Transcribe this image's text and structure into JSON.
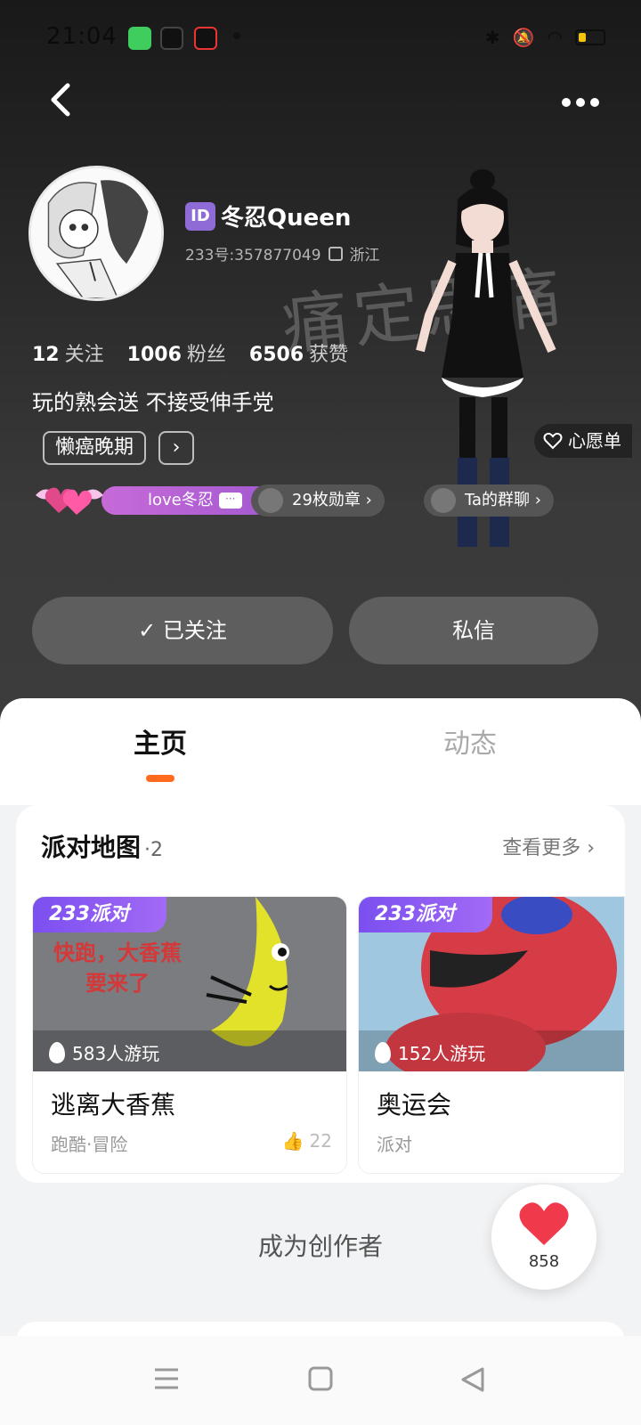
{
  "status_bar": {
    "time": "21:04",
    "apps": [
      "wechat-app-icon",
      "tiktok-icon",
      "tiktok-lite-icon"
    ]
  },
  "profile": {
    "id_badge": "ID",
    "username": "冬忍Queen",
    "uid": "233号:357877049",
    "location": "浙江",
    "watermark": "痛定思痛",
    "stats": [
      {
        "num": "12",
        "label": "关注"
      },
      {
        "num": "1006",
        "label": "粉丝"
      },
      {
        "num": "6506",
        "label": "获赞"
      }
    ],
    "bio": "玩的熟会送 不接受伸手党",
    "tag": "懒癌晚期",
    "wishlist": "心愿单",
    "love_pill": "love冬忍",
    "badges_pill": "29枚勋章",
    "group_pill": "Ta的群聊"
  },
  "actions": {
    "follow": "已关注",
    "message": "私信"
  },
  "tabs": [
    {
      "label": "主页"
    },
    {
      "label": "动态"
    }
  ],
  "party_map": {
    "title": "派对地图",
    "count": "·2",
    "more": "查看更多",
    "games": [
      {
        "badge": "233派对",
        "players": "583人游玩",
        "name": "逃离大香蕉",
        "category": "跑酷·冒险",
        "likes": "22",
        "thumb_text": "快跑，大香蕉\n要来了"
      },
      {
        "badge": "233派对",
        "players": "152人游玩",
        "name": "奥运会",
        "category": "派对",
        "likes": ""
      }
    ]
  },
  "creator": "成为创作者",
  "fab": {
    "count": "858"
  },
  "colors": {
    "accent": "#ff6a1f",
    "badge_purple": "#8e6bd6",
    "love_pill": "#b05fd4"
  }
}
